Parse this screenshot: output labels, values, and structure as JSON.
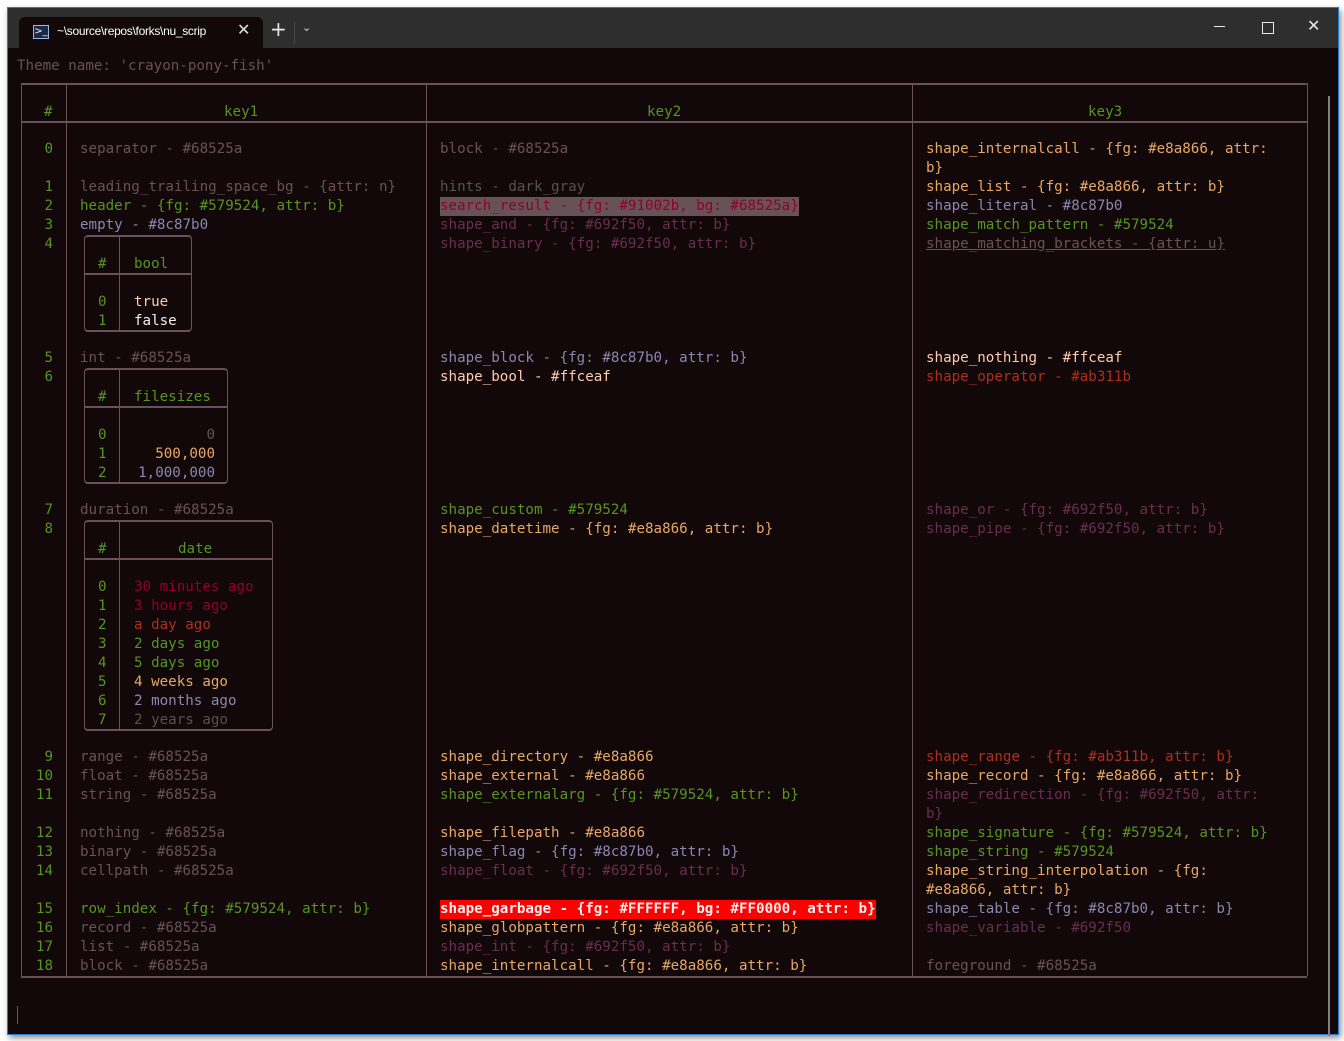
{
  "window": {
    "tab_title": "~\\source\\repos\\forks\\nu_scrip",
    "tab_icon": "powershell-icon",
    "close_tab": "✕",
    "new_tab": "+",
    "dropdown": "⌄",
    "minimize": "minimize-icon",
    "maximize": "maximize-icon",
    "close": "✕"
  },
  "colors": {
    "background": "#120709",
    "separator": "#68525a",
    "green": "#579524",
    "purple": "#8c87b0",
    "orange": "#e8a866",
    "cream": "#ffceaf",
    "wine": "#692f50",
    "red": "#ab311b",
    "crimson": "#91002b",
    "garbage_bg": "#FF0000"
  },
  "theme_line": "Theme name: 'crayon-pony-fish'",
  "table": {
    "headers": [
      "#",
      "key1",
      "key2",
      "key3"
    ],
    "rows": [
      {
        "index": "0",
        "key1": "separator - #68525a",
        "key2": "block - #68525a",
        "key3a": "shape_internalcall - {fg: #e8a866, attr:",
        "key3b": "b}"
      },
      {
        "index": "1",
        "key1": "leading_trailing_space_bg - {attr: n}",
        "key2": "hints - dark_gray",
        "key3": "shape_list - {fg: #e8a866, attr: b}"
      },
      {
        "index": "2",
        "key1": "header - {fg: #579524, attr: b}",
        "key2": "search_result - {fg: #91002b, bg: #68525a}",
        "key3": "shape_literal - #8c87b0"
      },
      {
        "index": "3",
        "key1": "empty - #8c87b0",
        "key2": "shape_and - {fg: #692f50, attr: b}",
        "key3": "shape_match_pattern - #579524"
      },
      {
        "index": "4",
        "key2": "shape_binary - {fg: #692f50, attr: b}",
        "key3": "shape_matching_brackets - {attr: u}"
      },
      {
        "index": "5",
        "key1": "int - #68525a",
        "key2": "shape_block - {fg: #8c87b0, attr: b}",
        "key3": "shape_nothing - #ffceaf"
      },
      {
        "index": "6",
        "key2": "shape_bool - #ffceaf",
        "key3": "shape_operator - #ab311b"
      },
      {
        "index": "7",
        "key1": "duration - #68525a",
        "key2": "shape_custom - #579524",
        "key3": "shape_or - {fg: #692f50, attr: b}"
      },
      {
        "index": "8",
        "key2": "shape_datetime - {fg: #e8a866, attr: b}",
        "key3": "shape_pipe - {fg: #692f50, attr: b}"
      },
      {
        "index": "9",
        "key1": "range - #68525a",
        "key2": "shape_directory - #e8a866",
        "key3": "shape_range - {fg: #ab311b, attr: b}"
      },
      {
        "index": "10",
        "key1": "float - #68525a",
        "key2": "shape_external - #e8a866",
        "key3": "shape_record - {fg: #e8a866, attr: b}"
      },
      {
        "index": "11",
        "key1": "string - #68525a",
        "key2": "shape_externalarg - {fg: #579524, attr: b}",
        "key3a": "shape_redirection - {fg: #692f50, attr:",
        "key3b": "b}"
      },
      {
        "index": "12",
        "key1": "nothing - #68525a",
        "key2": "shape_filepath - #e8a866",
        "key3": "shape_signature - {fg: #579524, attr: b}"
      },
      {
        "index": "13",
        "key1": "binary - #68525a",
        "key2": "shape_flag - {fg: #8c87b0, attr: b}",
        "key3": "shape_string - #579524"
      },
      {
        "index": "14",
        "key1": "cellpath - #68525a",
        "key2": "shape_float - {fg: #692f50, attr: b}",
        "key3a": "shape_string_interpolation - {fg:",
        "key3b": "#e8a866, attr: b}"
      },
      {
        "index": "15",
        "key1": "row_index - {fg: #579524, attr: b}",
        "key2": "shape_garbage - {fg: #FFFFFF, bg: #FF0000, attr: b}",
        "key3": "shape_table - {fg: #8c87b0, attr: b}"
      },
      {
        "index": "16",
        "key1": "record - #68525a",
        "key2": "shape_globpattern - {fg: #e8a866, attr: b}",
        "key3": "shape_variable - #692f50"
      },
      {
        "index": "17",
        "key1": "list - #68525a",
        "key2": "shape_int - {fg: #692f50, attr: b}"
      },
      {
        "index": "18",
        "key1": "block - #68525a",
        "key2": "shape_internalcall - {fg: #e8a866, attr: b}",
        "key3": "foreground - #68525a"
      }
    ]
  },
  "bool_table": {
    "headers": [
      "#",
      "bool"
    ],
    "rows": [
      {
        "index": "0",
        "value": "true"
      },
      {
        "index": "1",
        "value": "false"
      }
    ]
  },
  "filesize_table": {
    "headers": [
      "#",
      "filesizes"
    ],
    "rows": [
      {
        "index": "0",
        "value": "0"
      },
      {
        "index": "1",
        "value": "500,000"
      },
      {
        "index": "2",
        "value": "1,000,000"
      }
    ]
  },
  "date_table": {
    "headers": [
      "#",
      "date"
    ],
    "rows": [
      {
        "index": "0",
        "value": "30 minutes ago"
      },
      {
        "index": "1",
        "value": "3 hours ago"
      },
      {
        "index": "2",
        "value": "a day ago"
      },
      {
        "index": "3",
        "value": "2 days ago"
      },
      {
        "index": "4",
        "value": "5 days ago"
      },
      {
        "index": "5",
        "value": "4 weeks ago"
      },
      {
        "index": "6",
        "value": "2 months ago"
      },
      {
        "index": "7",
        "value": "2 years ago"
      }
    ]
  }
}
